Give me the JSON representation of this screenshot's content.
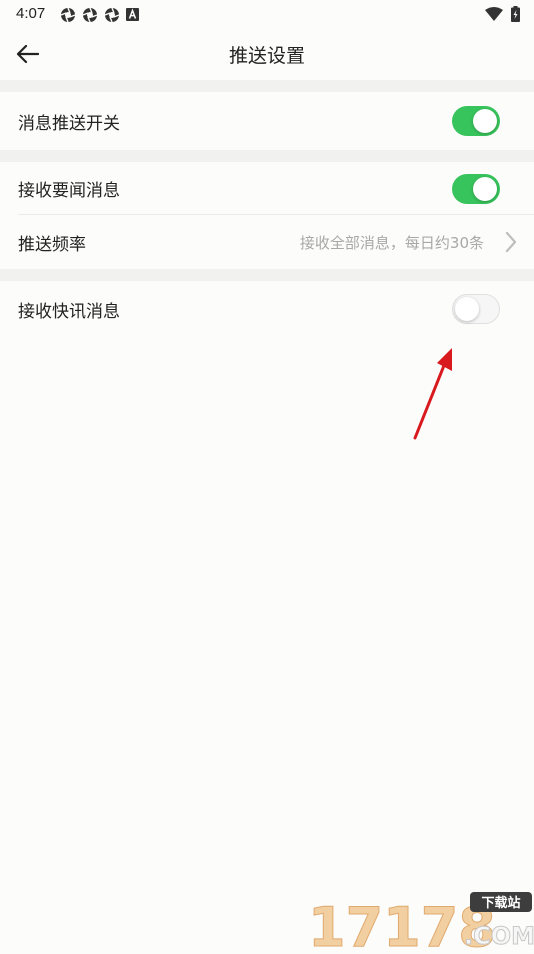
{
  "status_bar": {
    "time": "4:07"
  },
  "header": {
    "title": "推送设置"
  },
  "settings": {
    "push_switch": {
      "label": "消息推送开关",
      "on": true
    },
    "headline_news": {
      "label": "接收要闻消息",
      "on": true
    },
    "push_frequency": {
      "label": "推送频率",
      "value": "接收全部消息，每日约30条"
    },
    "flash_news": {
      "label": "接收快讯消息",
      "on": false
    }
  },
  "watermark": {
    "number": "17178",
    "tag": "下载站",
    "domain": ".COM"
  },
  "colors": {
    "toggle_on": "#38c45c",
    "arrow": "#d8191d"
  }
}
